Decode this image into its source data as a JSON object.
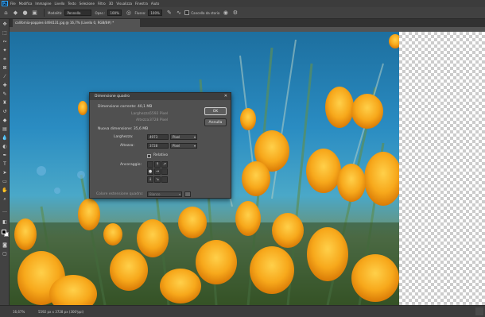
{
  "menubar": {
    "logo": "Ps",
    "items": [
      "File",
      "Modifica",
      "Immagine",
      "Livello",
      "Testo",
      "Selezione",
      "Filtro",
      "3D",
      "Visualizza",
      "Finestra",
      "Aiuto"
    ]
  },
  "options": {
    "mode_label": "Modalità:",
    "mode_value": "Pennello",
    "opacity_label": "Opac.:",
    "opacity_value": "100%",
    "flow_label": "Flusso:",
    "flow_value": "100%",
    "erase_label": "Cancella da storia"
  },
  "document": {
    "tab_title": "california-poppies-3494131.jpg @ 16,7% (Livello 0, RGB/8#) *"
  },
  "dialog": {
    "title": "Dimensione quadro",
    "current_size_label": "Dimensione corrente: 40,1 MB",
    "current_width_label": "Larghezza:",
    "current_width_value": "5592 Pixel",
    "current_height_label": "Altezza:",
    "current_height_value": "3728 Pixel",
    "new_size_label": "Nuova dimensione: 35,6 MB",
    "width_label": "Larghezza:",
    "width_value": "4973",
    "height_label": "Altezza:",
    "height_value": "3728",
    "unit": "Pixel",
    "relative_label": "Relativo",
    "anchor_label": "Ancoraggio:",
    "extension_color_label": "Colore estensione quadro:",
    "extension_color_value": "Bianco",
    "ok_label": "OK",
    "cancel_label": "Annulla"
  },
  "status": {
    "zoom": "16,67%",
    "doc_info": "5592 px x 3728 px (300 ppi)"
  },
  "colors": {
    "foreground": "#000000",
    "background": "#ffffff"
  }
}
